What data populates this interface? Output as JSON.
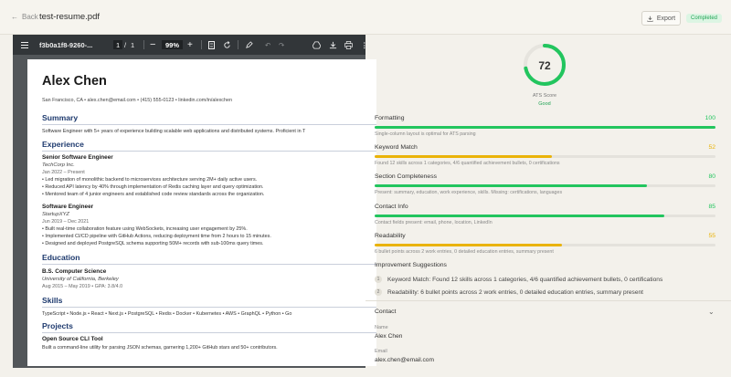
{
  "header": {
    "back_label": "Back",
    "filename": "test-resume.pdf",
    "export_label": "Export",
    "status": "Completed"
  },
  "pdf_toolbar": {
    "title": "f3b0a1f8-9260-...",
    "page": "1",
    "page_sep": "/",
    "total_pages": "1",
    "zoom": "99%"
  },
  "resume": {
    "name": "Alex Chen",
    "contact": "San Francisco, CA • alex.chen@email.com • (415) 555-0123 • linkedin.com/in/alexchen",
    "summary_heading": "Summary",
    "summary": "Software Engineer with 5+ years of experience building scalable web applications and distributed systems. Proficient in T",
    "experience_heading": "Experience",
    "jobs": [
      {
        "title": "Senior Software Engineer",
        "company": "TechCorp Inc.",
        "dates": "Jan 2022 – Present",
        "bullets": [
          "• Led migration of monolithic backend to microservices architecture serving 2M+ daily active users.",
          "• Reduced API latency by 40% through implementation of Redis caching layer and query optimization.",
          "• Mentored team of 4 junior engineers and established code review standards across the organization."
        ]
      },
      {
        "title": "Software Engineer",
        "company": "StartupXYZ",
        "dates": "Jun 2019 – Dec 2021",
        "bullets": [
          "• Built real-time collaboration feature using WebSockets, increasing user engagement by 25%.",
          "• Implemented CI/CD pipeline with GitHub Actions, reducing deployment time from 2 hours to 15 minutes.",
          "• Designed and deployed PostgreSQL schema supporting 50M+ records with sub-100ms query times."
        ]
      }
    ],
    "education_heading": "Education",
    "degree": "B.S. Computer Science",
    "school": "University of California, Berkeley",
    "edu_dates": "Aug 2015 – May 2019 • GPA: 3.8/4.0",
    "skills_heading": "Skills",
    "skills": "TypeScript • Node.js • React • Next.js • PostgreSQL • Redis • Docker • Kubernetes • AWS • GraphQL • Python • Go",
    "projects_heading": "Projects",
    "project_title": "Open Source CLI Tool",
    "project_desc": "Built a command-line utility for parsing JSON schemas, garnering 1,200+ GitHub stars and 50+ contributors."
  },
  "ats": {
    "score": "72",
    "score_fraction": 0.72,
    "label": "ATS Score",
    "grade": "Good",
    "color": "#22c55e"
  },
  "metrics": [
    {
      "name": "Formatting",
      "score": "100",
      "fraction": 1.0,
      "color": "#22c55e",
      "description": "Single-column layout is optimal for ATS parsing"
    },
    {
      "name": "Keyword Match",
      "score": "52",
      "fraction": 0.52,
      "color": "#eab308",
      "description": "Found 12 skills across 1 categories, 4/6 quantified achievement bullets, 0 certifications"
    },
    {
      "name": "Section Completeness",
      "score": "80",
      "fraction": 0.8,
      "color": "#22c55e",
      "description": "Present: summary, education, work experience, skills. Missing: certifications, languages"
    },
    {
      "name": "Contact Info",
      "score": "85",
      "fraction": 0.85,
      "color": "#22c55e",
      "description": "Contact fields present: email, phone, location, LinkedIn"
    },
    {
      "name": "Readability",
      "score": "55",
      "fraction": 0.55,
      "color": "#eab308",
      "description": "6 bullet points across 2 work entries, 0 detailed education entries, summary present"
    }
  ],
  "improvements": {
    "title": "Improvement Suggestions",
    "items": [
      {
        "num": "1",
        "text": "Keyword Match: Found 12 skills across 1 categories, 4/6 quantified achievement bullets, 0 certifications"
      },
      {
        "num": "2",
        "text": "Readability: 6 bullet points across 2 work entries, 0 detailed education entries, summary present"
      }
    ]
  },
  "contact": {
    "heading": "Contact",
    "name_label": "Name",
    "name": "Alex Chen",
    "email_label": "Email",
    "email": "alex.chen@email.com"
  },
  "icons": {
    "back": "arrow-left-icon",
    "export": "download-icon",
    "menu": "hamburger-icon",
    "zoom_out": "minus-icon",
    "zoom_in": "plus-icon",
    "fit": "fit-page-icon",
    "rotate": "rotate-icon",
    "annotate": "pen-icon",
    "undo": "undo-icon",
    "redo": "redo-icon",
    "drive": "drive-icon",
    "download": "download-icon",
    "print": "print-icon",
    "more": "more-vertical-icon",
    "collapse": "chevron-down-icon"
  }
}
